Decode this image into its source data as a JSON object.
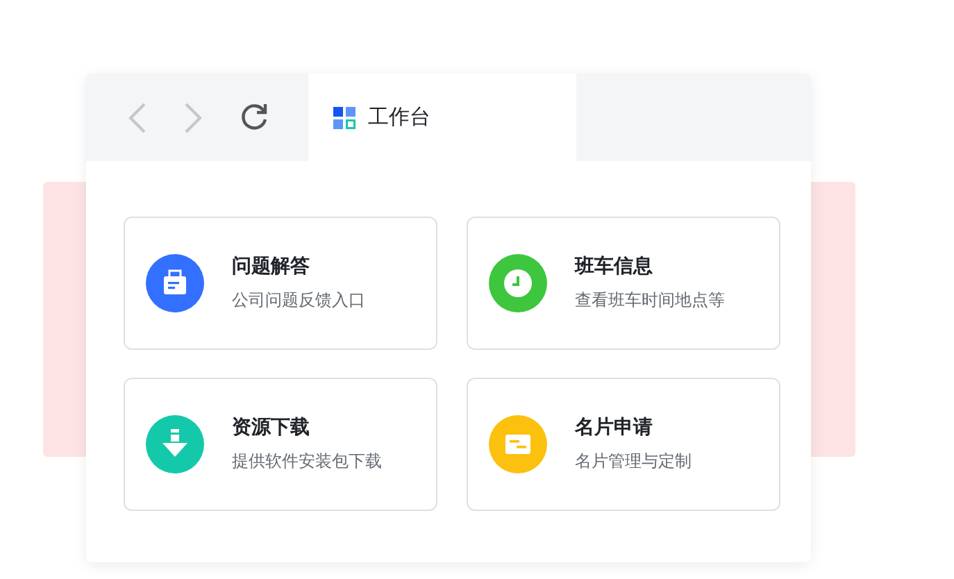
{
  "toolbar": {
    "nav": [
      {
        "kind": "back",
        "disabled": true
      },
      {
        "kind": "forward",
        "disabled": true
      },
      {
        "kind": "refresh",
        "disabled": false
      }
    ]
  },
  "tabs": [
    {
      "label": "工作台",
      "selected": true
    }
  ],
  "apps": [
    {
      "kind": "ticket",
      "color": "#3370ff",
      "title": "问题解答",
      "subtitle": "公司问题反馈入口"
    },
    {
      "kind": "clock",
      "color": "#3ec63e",
      "title": "班车信息",
      "subtitle": "查看班车时间地点等"
    },
    {
      "kind": "download",
      "color": "#14c9a9",
      "title": "资源下载",
      "subtitle": "提供软件安装包下载"
    },
    {
      "kind": "card",
      "color": "#fcc00e",
      "title": "名片申请",
      "subtitle": "名片管理与定制"
    }
  ]
}
